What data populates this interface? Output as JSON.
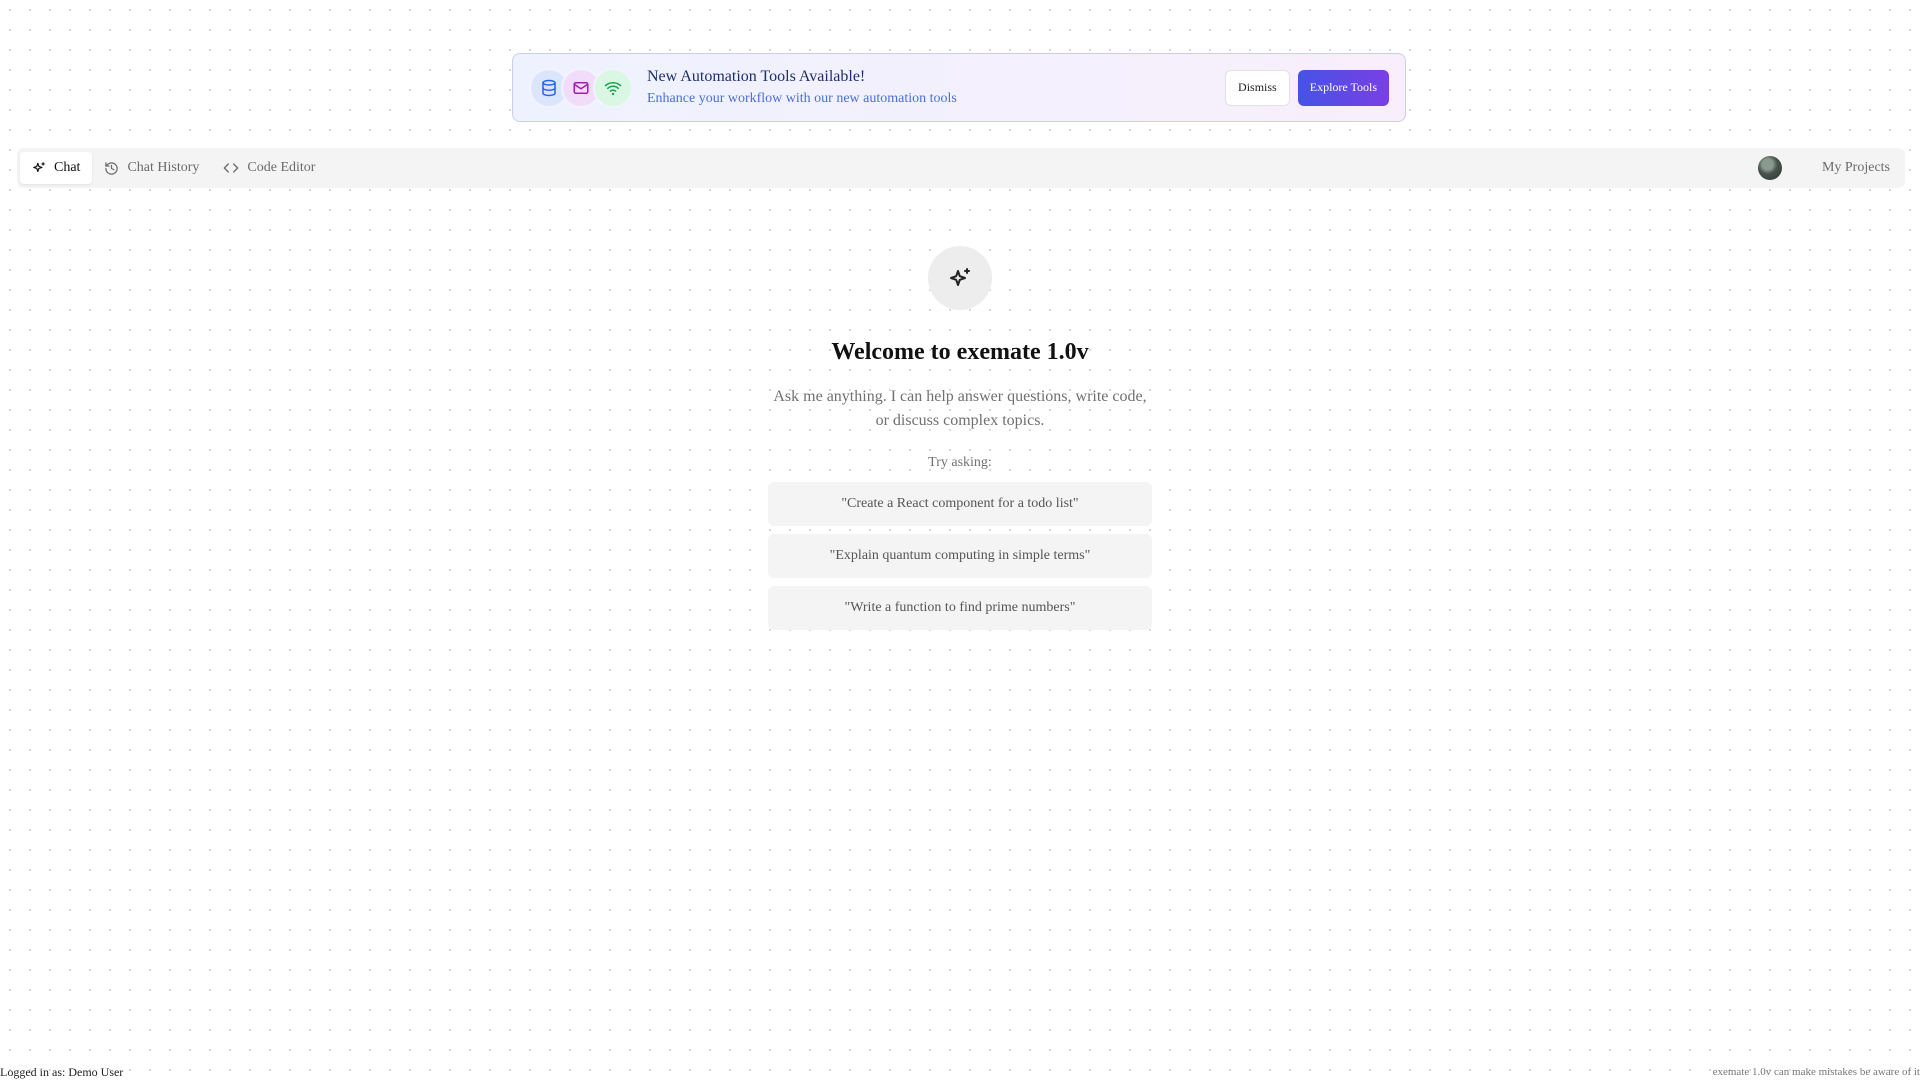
{
  "banner": {
    "icons": [
      "database-icon",
      "mail-icon",
      "wifi-icon"
    ],
    "title": "New Automation Tools Available!",
    "subtitle": "Enhance your workflow with our new automation tools",
    "dismiss_label": "Dismiss",
    "explore_label": "Explore Tools"
  },
  "nav": {
    "tabs": [
      {
        "label": "Chat",
        "icon": "sparkles-icon",
        "active": true
      },
      {
        "label": "Chat History",
        "icon": "history-icon",
        "active": false
      },
      {
        "label": "Code Editor",
        "icon": "code-icon",
        "active": false
      }
    ],
    "projects_label": "My Projects"
  },
  "welcome": {
    "title": "Welcome to exemate 1.0v",
    "description": "Ask me anything. I can help answer questions, write code, or discuss complex topics.",
    "try_label": "Try asking:",
    "suggestions": [
      "\"Create a React component for a todo list\"",
      "\"Explain quantum computing in simple terms\"",
      "\"Write a function to find prime numbers\""
    ]
  },
  "footer": {
    "user": "Logged in as: Demo User",
    "disclaimer": "exemate 1.0v can make mistakes be aware of it"
  },
  "colors": {
    "accent_start": "#4553e6",
    "accent_end": "#7a3fe4",
    "banner_title": "#1e2e6b",
    "banner_subtitle": "#4a6fd8"
  }
}
